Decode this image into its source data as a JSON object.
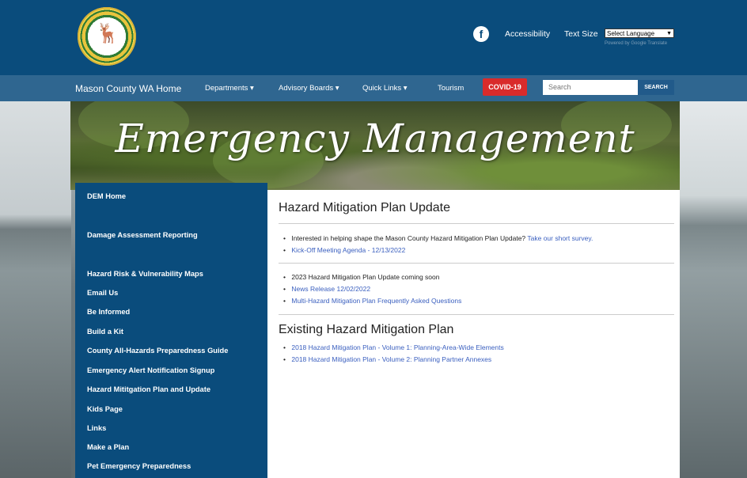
{
  "header": {
    "accessibility_label": "Accessibility",
    "text_size_label": "Text Size",
    "language_select_value": "Select Language",
    "powered_by": "Powered by Google Translate"
  },
  "nav": {
    "home": "Mason County WA Home",
    "items": [
      "Departments ▾",
      "Advisory Boards ▾",
      "Quick Links ▾",
      "Tourism"
    ],
    "covid": "COVID-19",
    "search_placeholder": "Search",
    "search_button": "SEARCH"
  },
  "banner": {
    "title": "Emergency Management"
  },
  "sidebar": {
    "items": [
      "DEM Home",
      "Damage Assessment Reporting",
      "Hazard Risk & Vulnerability Maps",
      "Email Us",
      "Be Informed",
      "Build a Kit",
      "County All-Hazards Preparedness Guide",
      "Emergency Alert Notification Signup",
      "Hazard Mititgation Plan and Update",
      "Kids Page",
      "Links",
      "Make a Plan",
      "Pet Emergency Preparedness"
    ]
  },
  "main": {
    "section1_title": "Hazard Mitigation Plan Update",
    "survey_text": "Interested in helping shape the Mason County Hazard Mitigation Plan Update?",
    "survey_link": "Take our short survey.",
    "kickoff_link": "Kick-Off Meeting Agenda - 12/13/2022",
    "coming_soon": "2023 Hazard Mitigation Plan Update coming soon",
    "news_link": "News Release 12/02/2022",
    "faq_link": "Multi-Hazard Mitigation Plan Frequently Asked Questions",
    "section2_title": "Existing Hazard Mitigation Plan",
    "vol1_link": "2018 Hazard Mitigation Plan - Volume 1: Planning-Area-Wide Elements",
    "vol2_link": "2018 Hazard Mitigation Plan - Volume 2: Planning Partner Annexes"
  }
}
